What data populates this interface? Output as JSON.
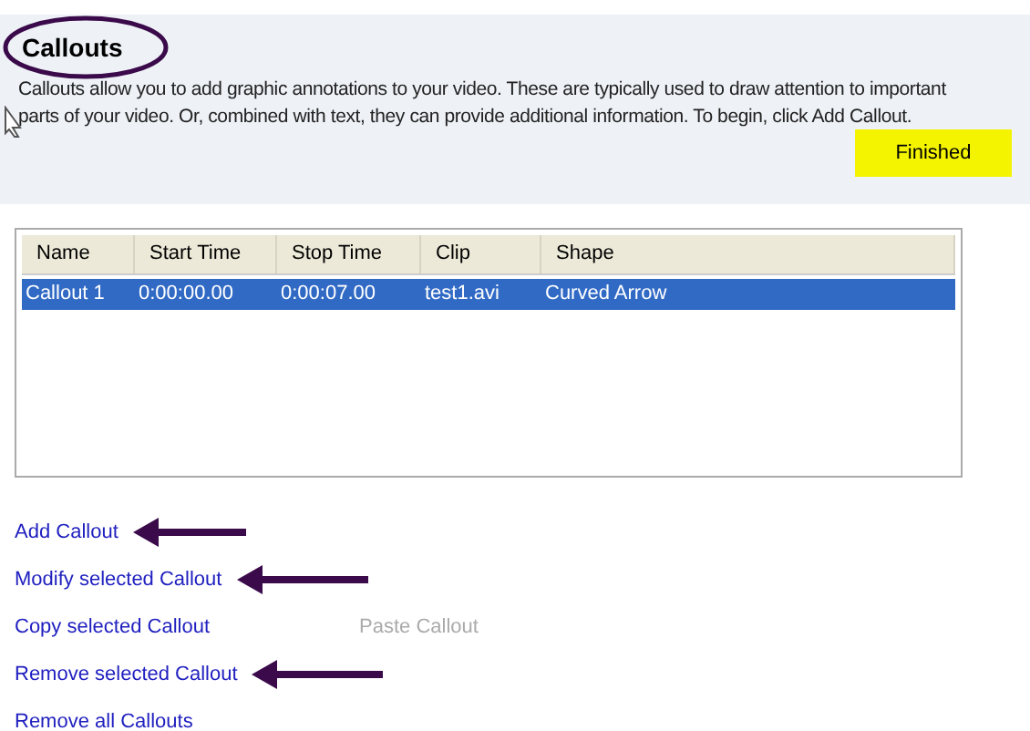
{
  "header": {
    "title": "Callouts",
    "description": "Callouts allow you to add graphic annotations to your video. These are typically used to draw attention to important parts of your video. Or, combined with text, they can provide additional information. To begin, click Add Callout.",
    "finish_button": "Finished"
  },
  "table": {
    "columns": [
      "Name",
      "Start Time",
      "Stop Time",
      "Clip",
      "Shape"
    ],
    "rows": [
      {
        "cells": [
          "Callout 1",
          "0:00:00.00",
          "0:00:07.00",
          "test1.avi",
          "Curved Arrow"
        ],
        "selected": true
      }
    ]
  },
  "links": [
    {
      "label": "Add Callout",
      "annotated": true
    },
    {
      "label": "Modify selected Callout",
      "annotated": true
    },
    {
      "label": "Copy selected Callout",
      "annotated": false,
      "side_link": {
        "label": "Paste Callout",
        "disabled": true
      }
    },
    {
      "label": "Remove selected Callout",
      "annotated": true
    },
    {
      "label": "Remove all Callouts",
      "annotated": false
    }
  ]
}
